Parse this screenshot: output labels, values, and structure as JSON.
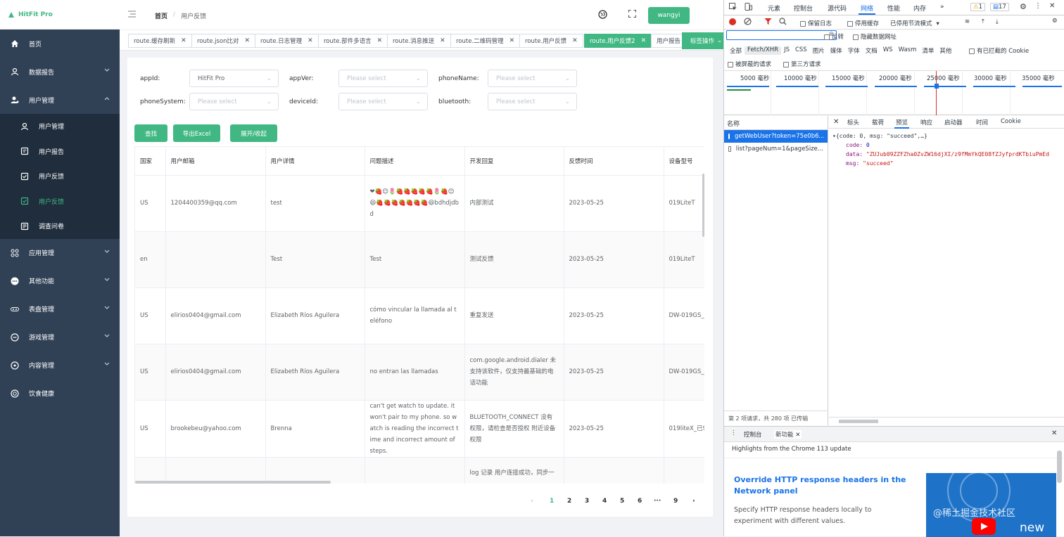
{
  "brand": {
    "name": "HitFit Pro",
    "color": "#41b883"
  },
  "sidebar": {
    "items": [
      {
        "label": "首页",
        "icon": "home-icon"
      },
      {
        "label": "数据报告",
        "icon": "user-icon"
      },
      {
        "label": "用户管理",
        "icon": "users-icon"
      },
      {
        "label": "应用管理",
        "icon": "grid-icon"
      },
      {
        "label": "其他功能",
        "icon": "more-icon"
      },
      {
        "label": "表盘管理",
        "icon": "dial-icon"
      },
      {
        "label": "游戏管理",
        "icon": "game-icon"
      },
      {
        "label": "内容管理",
        "icon": "content-icon"
      },
      {
        "label": "饮食健康",
        "icon": "health-icon"
      }
    ],
    "sub": [
      {
        "label": "用户管理"
      },
      {
        "label": "用户报告"
      },
      {
        "label": "用户反馈"
      },
      {
        "label": "用户反馈"
      },
      {
        "label": "调查问卷"
      }
    ]
  },
  "header": {
    "breadcrumb_home": "首页",
    "breadcrumb_sep": "/",
    "breadcrumb_current": "用户反馈",
    "user": "wangyi"
  },
  "tags": [
    {
      "label": "route.缓存刷新"
    },
    {
      "label": "route.json比对"
    },
    {
      "label": "route.日志管理"
    },
    {
      "label": "route.部件多语言"
    },
    {
      "label": "route.消息推送"
    },
    {
      "label": "route.二维码管理"
    },
    {
      "label": "route.用户反馈"
    },
    {
      "label": "route.用户反馈2"
    },
    {
      "label": "用户报告"
    }
  ],
  "tag_ops": "标签操作",
  "filters": {
    "appId": {
      "label": "appId:",
      "value": "HitFit Pro"
    },
    "appVer": {
      "label": "appVer:",
      "placeholder": "Please select"
    },
    "phoneName": {
      "label": "phoneName:",
      "placeholder": "Please select"
    },
    "phoneSystem": {
      "label": "phoneSystem:",
      "placeholder": "Please select"
    },
    "deviceId": {
      "label": "deviceId:",
      "placeholder": "Please select"
    },
    "bluetooth": {
      "label": "bluetooth:",
      "placeholder": "Please select"
    }
  },
  "buttons": {
    "search": "查找",
    "export": "导出Excel",
    "toggle": "展开/收起"
  },
  "table": {
    "columns": [
      "国家",
      "用户邮箱",
      "用户详情",
      "问题描述",
      "开发回复",
      "反馈时间",
      "设备型号"
    ],
    "rows": [
      [
        "US",
        "1204400359@qq.com",
        "test",
        "❤🍓😊🌷🍓🍓🍓🍓🍓🌷🍓😊😆🍓🍓🍓🍓🍓🍓🍓😆bdhdjdbd",
        "内部测试",
        "2023-05-25",
        "019LiteT"
      ],
      [
        "en",
        "",
        "Test",
        "Test",
        "测试反馈",
        "2023-05-25",
        "019LiteT"
      ],
      [
        "US",
        "elirios0404@gmail.com",
        "Elizabeth Ríos Aguilera",
        "cómo vincular la llamada al teléfono",
        "重复发送",
        "2023-05-25",
        "DW-019GS_"
      ],
      [
        "US",
        "elirios0404@gmail.com",
        "Elizabeth Ríos Aguilera",
        "no entran las llamadas",
        "com.google.android.dialer 未支持该软件，仅支持最基础的电话功能",
        "2023-05-25",
        "DW-019GS_"
      ],
      [
        "US",
        "brookebeu@yahoo.com",
        "Brenna",
        "can't get watch to update. it won't pair to my phone. so watch is reading the incorrect time and incorrect amount of steps.",
        "BLUETOOTH_CONNECT 没有权限，请检查是否授权 附近设备权限",
        "2023-05-25",
        "019liteX_已9"
      ],
      [
        "",
        "",
        "",
        "",
        "log 记录 用户连接成功，同步一",
        "",
        ""
      ]
    ]
  },
  "pagination": {
    "prev": "‹",
    "pages": [
      "1",
      "2",
      "3",
      "4",
      "5",
      "6",
      "···",
      "9"
    ],
    "next": "›",
    "current": "1"
  },
  "devtools": {
    "tabs": [
      "元素",
      "控制台",
      "源代码",
      "网络",
      "性能",
      "内存",
      "»"
    ],
    "warn_count": "1",
    "msg_count": "17",
    "toolbar": {
      "preserve_log": "保留日志",
      "disable_cache": "停用缓存",
      "throttle": "已停用节流模式"
    },
    "filter_opts": {
      "invert": "反转",
      "hide_data": "隐藏数据网址"
    },
    "types": [
      "全部",
      "Fetch/XHR",
      "JS",
      "CSS",
      "图片",
      "媒体",
      "字体",
      "文档",
      "WS",
      "Wasm",
      "清单",
      "其他"
    ],
    "blocked_cookies": "有已拦截的 Cookie",
    "blocked_requests": "被屏蔽的请求",
    "third_party": "第三方请求",
    "timeline": [
      "5000 毫秒",
      "10000 毫秒",
      "15000 毫秒",
      "20000 毫秒",
      "25000 毫秒",
      "30000 毫秒",
      "35000 毫秒"
    ],
    "list_header": "名称",
    "requests": [
      "getWebUser?token=75e0b6...",
      "list?pageNum=1&pageSize..."
    ],
    "status": "第 2 项请求，共 280 项  已传输",
    "detail_tabs": [
      "标头",
      "载荷",
      "预览",
      "响应",
      "启动器",
      "时间",
      "Cookie"
    ],
    "preview": {
      "summary": "{code: 0, msg: \"succeed\",…}",
      "code_key": "code:",
      "code_val": "0",
      "data_key": "data:",
      "data_val": "\"ZUJub09ZZFZha0ZvZW16djXI/z9fMmYkQE08fZJyfprdKTbiuPmEd",
      "msg_key": "msg:",
      "msg_val": "\"succeed\""
    },
    "drawer_tabs": [
      "控制台",
      "新功能"
    ],
    "highlights": "Highlights from the Chrome 113 update",
    "feature_title": "Override HTTP response headers in the Network panel",
    "feature_desc": "Specify HTTP response headers locally to experiment with different values.",
    "watermark": "@稀土掘金技术社区",
    "promo_text": "new"
  }
}
